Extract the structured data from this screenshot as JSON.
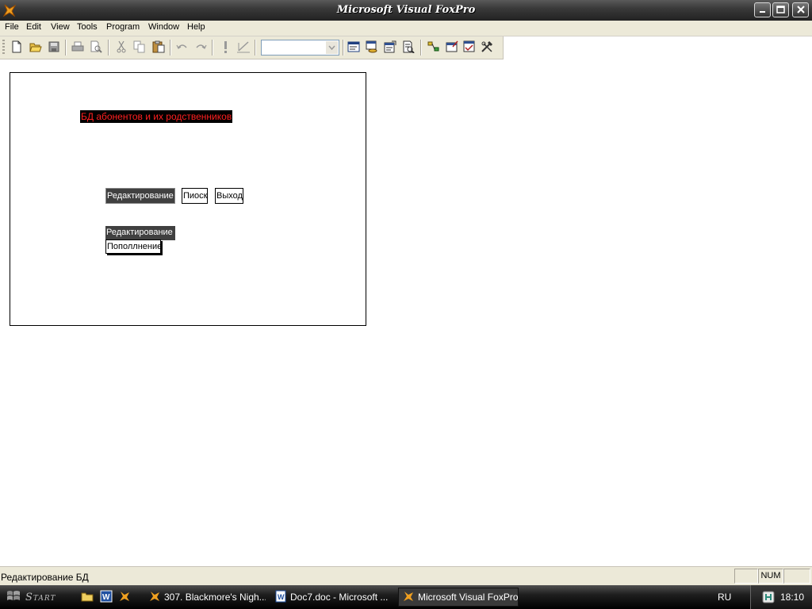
{
  "window": {
    "title": "Microsoft Visual FoxPro"
  },
  "menu": [
    "File",
    "Edit",
    "View",
    "Tools",
    "Program",
    "Window",
    "Help"
  ],
  "toolbar": {
    "icons": [
      "new-icon",
      "open-icon",
      "save-icon",
      "print-icon",
      "print-preview-icon",
      "cut-icon",
      "copy-icon",
      "paste-icon",
      "undo-icon",
      "redo-icon",
      "run-icon",
      "modify-form-icon",
      "command-window-icon",
      "view-window-icon",
      "properties-icon",
      "code-icon",
      "data-session-icon",
      "form-designer-icon",
      "class-browser-icon",
      "builder-icon"
    ],
    "combo_value": ""
  },
  "form": {
    "title": "БД абонентов и их родственников",
    "btn_edit": "Редактирование",
    "btn_search": "Пиоск",
    "btn_exit": "Выход",
    "popup_edit": "Редактирование",
    "popup_add": "Пополлнение"
  },
  "status": {
    "message": "Редактирование БД",
    "num": "NUM"
  },
  "taskbar": {
    "start": "Start",
    "tasks": [
      "307. Blackmore's Nigh...",
      "Doc7.doc - Microsoft ...",
      "Microsoft Visual FoxPro"
    ],
    "lang": "RU",
    "clock": "18:10"
  },
  "colors": {
    "title_text": "#ff2020",
    "dark_button": "#404040",
    "chrome": "#ece9d8"
  }
}
